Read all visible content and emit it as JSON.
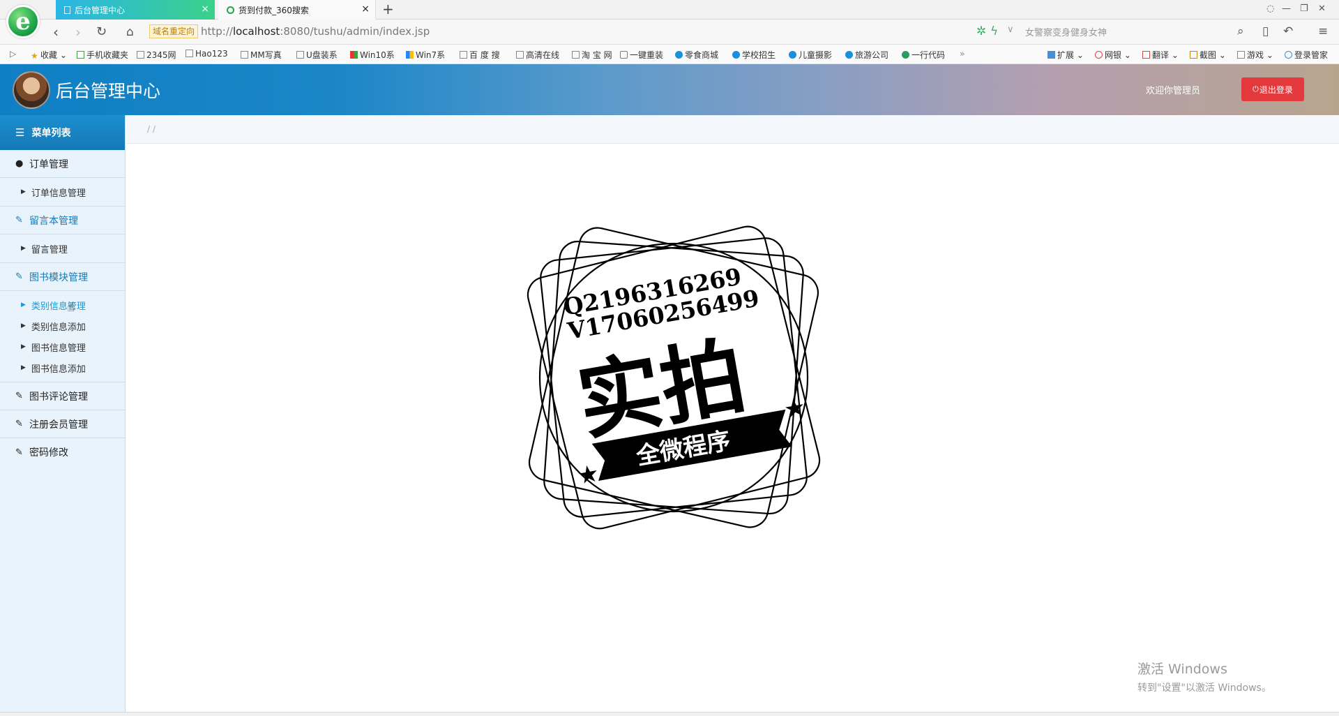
{
  "browser": {
    "tabs": [
      {
        "label": "后台管理中心",
        "active": true
      },
      {
        "label": "货到付款_360搜索",
        "active": false
      }
    ],
    "redirect_badge": "域名重定向",
    "url_prefix": "http://",
    "url_host": "localhost",
    "url_rest": ":8080/tushu/admin/index.jsp",
    "search_placeholder": "女警察变身健身女神",
    "bookmarks": [
      {
        "label": "收藏",
        "icon": "star-icon"
      },
      {
        "label": "手机收藏夹",
        "icon": "phone-icon"
      },
      {
        "label": "2345网",
        "icon": "page-icon"
      },
      {
        "label": "Hao123",
        "icon": "page-icon"
      },
      {
        "label": "MM写真",
        "icon": "page-icon"
      },
      {
        "label": "U盘装系",
        "icon": "page-icon"
      },
      {
        "label": "Win10系",
        "icon": "windows-icon"
      },
      {
        "label": "Win7系",
        "icon": "windows-icon"
      },
      {
        "label": "百 度 搜",
        "icon": "page-icon"
      },
      {
        "label": "高清在线",
        "icon": "page-icon"
      },
      {
        "label": "淘 宝 网",
        "icon": "page-icon"
      },
      {
        "label": "一键重装",
        "icon": "app-icon"
      },
      {
        "label": "零食商城",
        "icon": "m-icon"
      },
      {
        "label": "学校招生",
        "icon": "m-icon"
      },
      {
        "label": "儿童摄影",
        "icon": "m-icon"
      },
      {
        "label": "旅游公司",
        "icon": "m-icon"
      },
      {
        "label": "一行代码",
        "icon": "p-icon"
      }
    ],
    "right_tools": [
      {
        "label": "扩展"
      },
      {
        "label": "网银"
      },
      {
        "label": "翻译"
      },
      {
        "label": "截图"
      },
      {
        "label": "游戏"
      },
      {
        "label": "登录管家"
      }
    ]
  },
  "header": {
    "title": "后台管理中心",
    "welcome": "欢迎你管理员",
    "logout": "退出登录"
  },
  "sidebar": {
    "menu_title": "菜单列表",
    "groups": [
      {
        "label": "订单管理",
        "items": [
          "订单信息管理"
        ]
      },
      {
        "label": "留言本管理",
        "items": [
          "留言管理"
        ]
      },
      {
        "label": "图书模块管理",
        "items": [
          "类别信息管理",
          "类别信息添加",
          "图书信息管理",
          "图书信息添加"
        ]
      },
      {
        "label": "图书评论管理",
        "items": []
      },
      {
        "label": "注册会员管理",
        "items": []
      },
      {
        "label": "密码修改",
        "items": []
      }
    ]
  },
  "breadcrumb": "/ /",
  "stamp": {
    "line1": "Q2196316269",
    "line2": "V17060256499",
    "big": "实拍",
    "ribbon": "全微程序"
  },
  "watermark": {
    "line1": "激活 Windows",
    "line2": "转到\"设置\"以激活 Windows。"
  },
  "colors": {
    "accent": "#1678b6",
    "active_item": "#1a9ad6",
    "logout": "#e4393c"
  }
}
